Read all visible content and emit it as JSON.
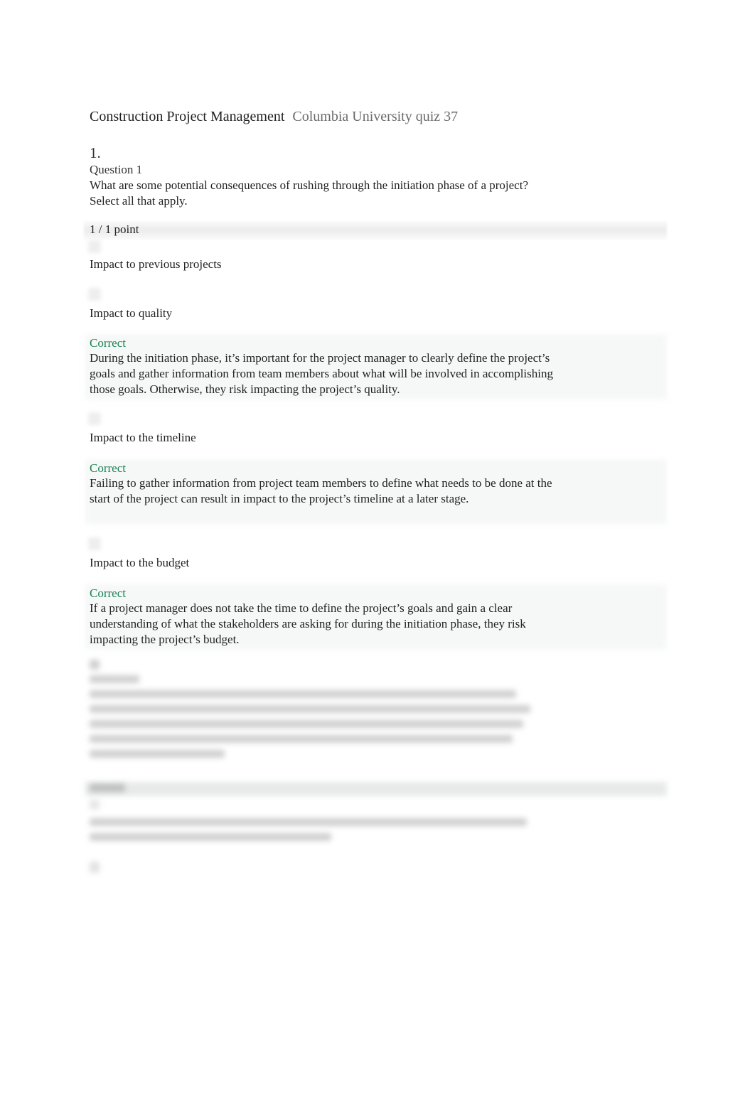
{
  "header": {
    "course_title": "Construction Project Management",
    "subtitle": "Columbia University quiz 37"
  },
  "question1": {
    "number": "1.",
    "label": "Question 1",
    "text": "What are some potential consequences of rushing through the initiation phase of a project? Select all that apply.",
    "score": "1 / 1 point",
    "options": [
      {
        "label": " Impact to previous projects",
        "selected": false
      },
      {
        "label": "Impact to quality",
        "selected": true,
        "feedback_status": "Correct",
        "feedback_text": "During the initiation phase, it’s important for the project manager to clearly define the project’s goals and gather information from team members about what will be involved in accomplishing those goals. Otherwise, they risk impacting the project’s quality."
      },
      {
        "label": "Impact to the timeline",
        "selected": true,
        "feedback_status": "Correct",
        "feedback_text": "Failing to gather information from project team members to define what needs to be done at the start of the project can result in impact to the project’s timeline at a later stage."
      },
      {
        "label": "Impact to the budget",
        "selected": true,
        "feedback_status": "Correct",
        "feedback_text": "If a project manager does not take the time to define the project’s goals and gain a clear understanding of what the stakeholders are asking for during the initiation phase, they risk impacting the project’s budget."
      }
    ]
  },
  "colors": {
    "correct": "#1f8354",
    "text": "#222222",
    "subtitle": "#6b6b6b"
  },
  "blurred_section": {
    "note": "content obscured"
  }
}
